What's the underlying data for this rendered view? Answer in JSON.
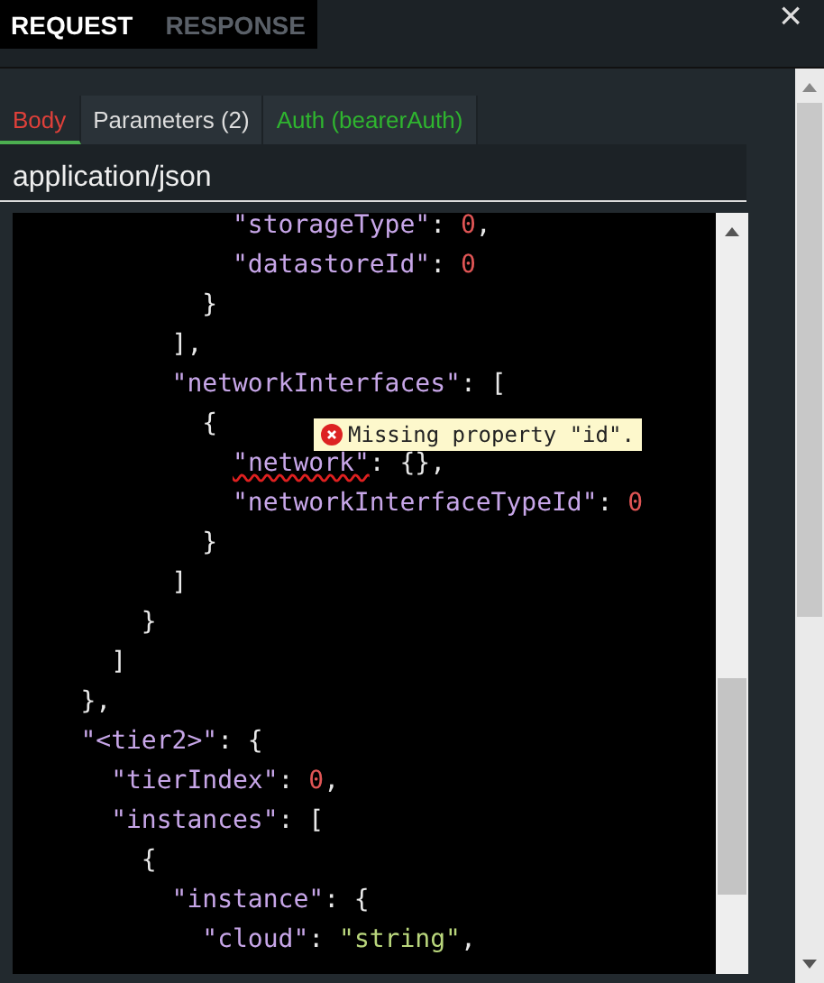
{
  "top_tabs": [
    {
      "label": "REQUEST",
      "selected": true
    },
    {
      "label": "RESPONSE",
      "selected": false
    }
  ],
  "close": "×",
  "sub_tabs": [
    {
      "label": "Body",
      "selected": true,
      "color": "#e0403a"
    },
    {
      "label": "Parameters (2)",
      "selected": false,
      "color": "#dddddd"
    },
    {
      "label": "Auth (bearerAuth)",
      "selected": false,
      "color": "#2fb52f"
    }
  ],
  "content_type": "application/json",
  "code_lines": [
    [
      {
        "kind": "key",
        "text": "              \"storageType\""
      },
      {
        "kind": "punct",
        "text": ": "
      },
      {
        "kind": "number",
        "text": "0"
      },
      {
        "kind": "punct",
        "text": ","
      }
    ],
    [
      {
        "kind": "key",
        "text": "              \"datastoreId\""
      },
      {
        "kind": "punct",
        "text": ": "
      },
      {
        "kind": "number",
        "text": "0"
      }
    ],
    [
      {
        "kind": "punct",
        "text": "            }"
      }
    ],
    [
      {
        "kind": "punct",
        "text": "          ],"
      }
    ],
    [
      {
        "kind": "key",
        "text": "          \"networkInterfaces\""
      },
      {
        "kind": "punct",
        "text": ": ["
      }
    ],
    [
      {
        "kind": "punct",
        "text": "            {"
      }
    ],
    [
      {
        "kind": "error",
        "text": "              \"network\""
      },
      {
        "kind": "punct",
        "text": ": {},"
      }
    ],
    [
      {
        "kind": "key",
        "text": "              \"networkInterfaceTypeId\""
      },
      {
        "kind": "punct",
        "text": ": "
      },
      {
        "kind": "number",
        "text": "0"
      }
    ],
    [
      {
        "kind": "punct",
        "text": "            }"
      }
    ],
    [
      {
        "kind": "punct",
        "text": "          ]"
      }
    ],
    [
      {
        "kind": "punct",
        "text": "        }"
      }
    ],
    [
      {
        "kind": "punct",
        "text": "      ]"
      }
    ],
    [
      {
        "kind": "punct",
        "text": "    },"
      }
    ],
    [
      {
        "kind": "key",
        "text": "    \"<tier2>\""
      },
      {
        "kind": "punct",
        "text": ": {"
      }
    ],
    [
      {
        "kind": "key",
        "text": "      \"tierIndex\""
      },
      {
        "kind": "punct",
        "text": ": "
      },
      {
        "kind": "number",
        "text": "0"
      },
      {
        "kind": "punct",
        "text": ","
      }
    ],
    [
      {
        "kind": "key",
        "text": "      \"instances\""
      },
      {
        "kind": "punct",
        "text": ": ["
      }
    ],
    [
      {
        "kind": "punct",
        "text": "        {"
      }
    ],
    [
      {
        "kind": "key",
        "text": "          \"instance\""
      },
      {
        "kind": "punct",
        "text": ": {"
      }
    ],
    [
      {
        "kind": "key",
        "text": "            \"cloud\""
      },
      {
        "kind": "punct",
        "text": ": "
      },
      {
        "kind": "string",
        "text": "\"string\""
      },
      {
        "kind": "punct",
        "text": ","
      }
    ]
  ],
  "error_tooltip": "Missing property \"id\"."
}
